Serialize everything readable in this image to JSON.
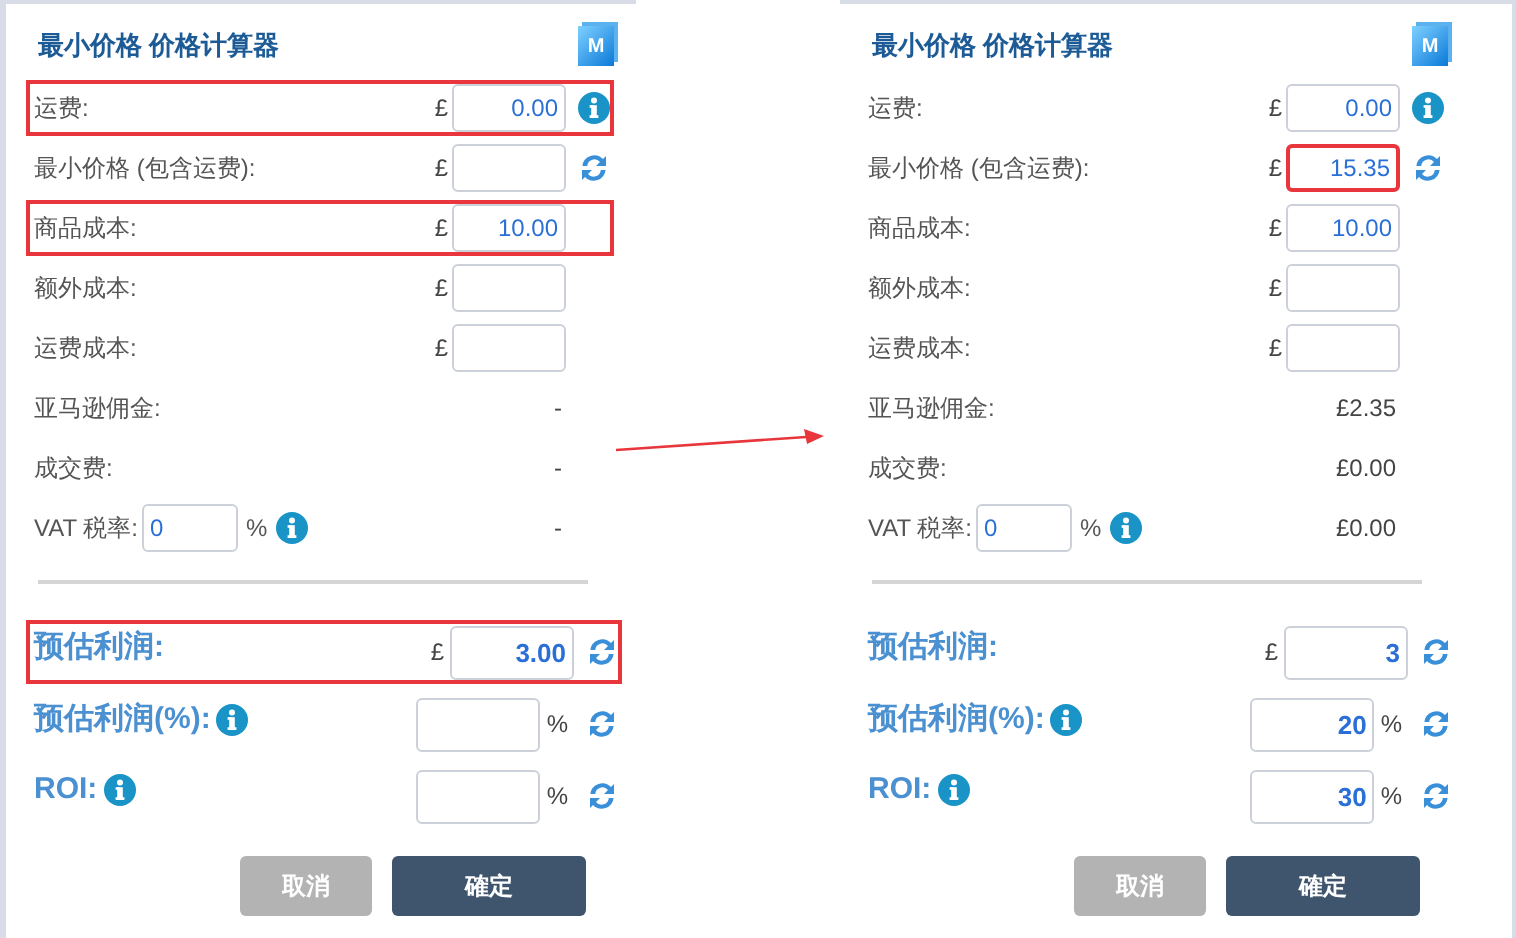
{
  "panels": [
    {
      "title": "最小价格 价格计算器",
      "logo_text": "M",
      "rows": [
        {
          "kind": "input",
          "label": "运费:",
          "unit": "£",
          "value": "0.00",
          "info": true,
          "refresh": false,
          "highlighted": true,
          "field_highlighted": false
        },
        {
          "kind": "input",
          "label": "最小价格 (包含运费):",
          "unit": "£",
          "info": false,
          "refresh": true,
          "highlighted": false,
          "field_highlighted": false
        },
        {
          "kind": "input",
          "label": "商品成本:",
          "unit": "£",
          "value": "10.00",
          "info": false,
          "refresh": false,
          "highlighted": true,
          "field_highlighted": false
        },
        {
          "kind": "input",
          "label": "额外成本:",
          "unit": "£",
          "info": false,
          "refresh": false,
          "highlighted": false,
          "field_highlighted": false
        },
        {
          "kind": "input",
          "label": "运费成本:",
          "unit": "£",
          "info": false,
          "refresh": false,
          "highlighted": false,
          "field_highlighted": false
        },
        {
          "kind": "readout",
          "label": "亚马逊佣金:",
          "value": "-"
        },
        {
          "kind": "readout",
          "label": "成交费:",
          "value": "-"
        },
        {
          "kind": "vat",
          "label": "VAT 税率:",
          "value": "0",
          "unit": "%",
          "result": "-"
        }
      ],
      "results": [
        {
          "label": "预估利润:",
          "info": false,
          "currency": "£",
          "value": "3.00",
          "highlighted": true
        },
        {
          "label": "预估利润(%):",
          "info": true,
          "percent": "%",
          "highlighted": false
        },
        {
          "label": "ROI:",
          "info": true,
          "percent": "%",
          "highlighted": false
        }
      ],
      "buttons": [
        {
          "label": "取消",
          "disabled": true
        },
        {
          "label": "確定",
          "disabled": false
        }
      ]
    },
    {
      "title": "最小价格 价格计算器",
      "logo_text": "M",
      "rows": [
        {
          "kind": "input",
          "label": "运费:",
          "unit": "£",
          "value": "0.00",
          "info": true,
          "refresh": false,
          "highlighted": false,
          "field_highlighted": false
        },
        {
          "kind": "input",
          "label": "最小价格 (包含运费):",
          "unit": "£",
          "value": "15.35",
          "info": false,
          "refresh": true,
          "highlighted": false,
          "field_highlighted": true
        },
        {
          "kind": "input",
          "label": "商品成本:",
          "unit": "£",
          "value": "10.00",
          "info": false,
          "refresh": false,
          "highlighted": false,
          "field_highlighted": false
        },
        {
          "kind": "input",
          "label": "额外成本:",
          "unit": "£",
          "info": false,
          "refresh": false,
          "highlighted": false,
          "field_highlighted": false
        },
        {
          "kind": "input",
          "label": "运费成本:",
          "unit": "£",
          "info": false,
          "refresh": false,
          "highlighted": false,
          "field_highlighted": false
        },
        {
          "kind": "readout",
          "label": "亚马逊佣金:",
          "value": "£2.35"
        },
        {
          "kind": "readout",
          "label": "成交费:",
          "value": "£0.00"
        },
        {
          "kind": "vat",
          "label": "VAT 税率:",
          "value": "0",
          "unit": "%",
          "result": "£0.00"
        }
      ],
      "results": [
        {
          "label": "预估利润:",
          "info": false,
          "currency": "£",
          "value": "3",
          "highlighted": false
        },
        {
          "label": "预估利润(%):",
          "info": true,
          "percent": "%",
          "value": "20",
          "highlighted": false
        },
        {
          "label": "ROI:",
          "info": true,
          "percent": "%",
          "value": "30",
          "highlighted": false
        }
      ],
      "buttons": [
        {
          "label": "取消",
          "disabled": true
        },
        {
          "label": "確定",
          "disabled": false
        }
      ]
    }
  ]
}
